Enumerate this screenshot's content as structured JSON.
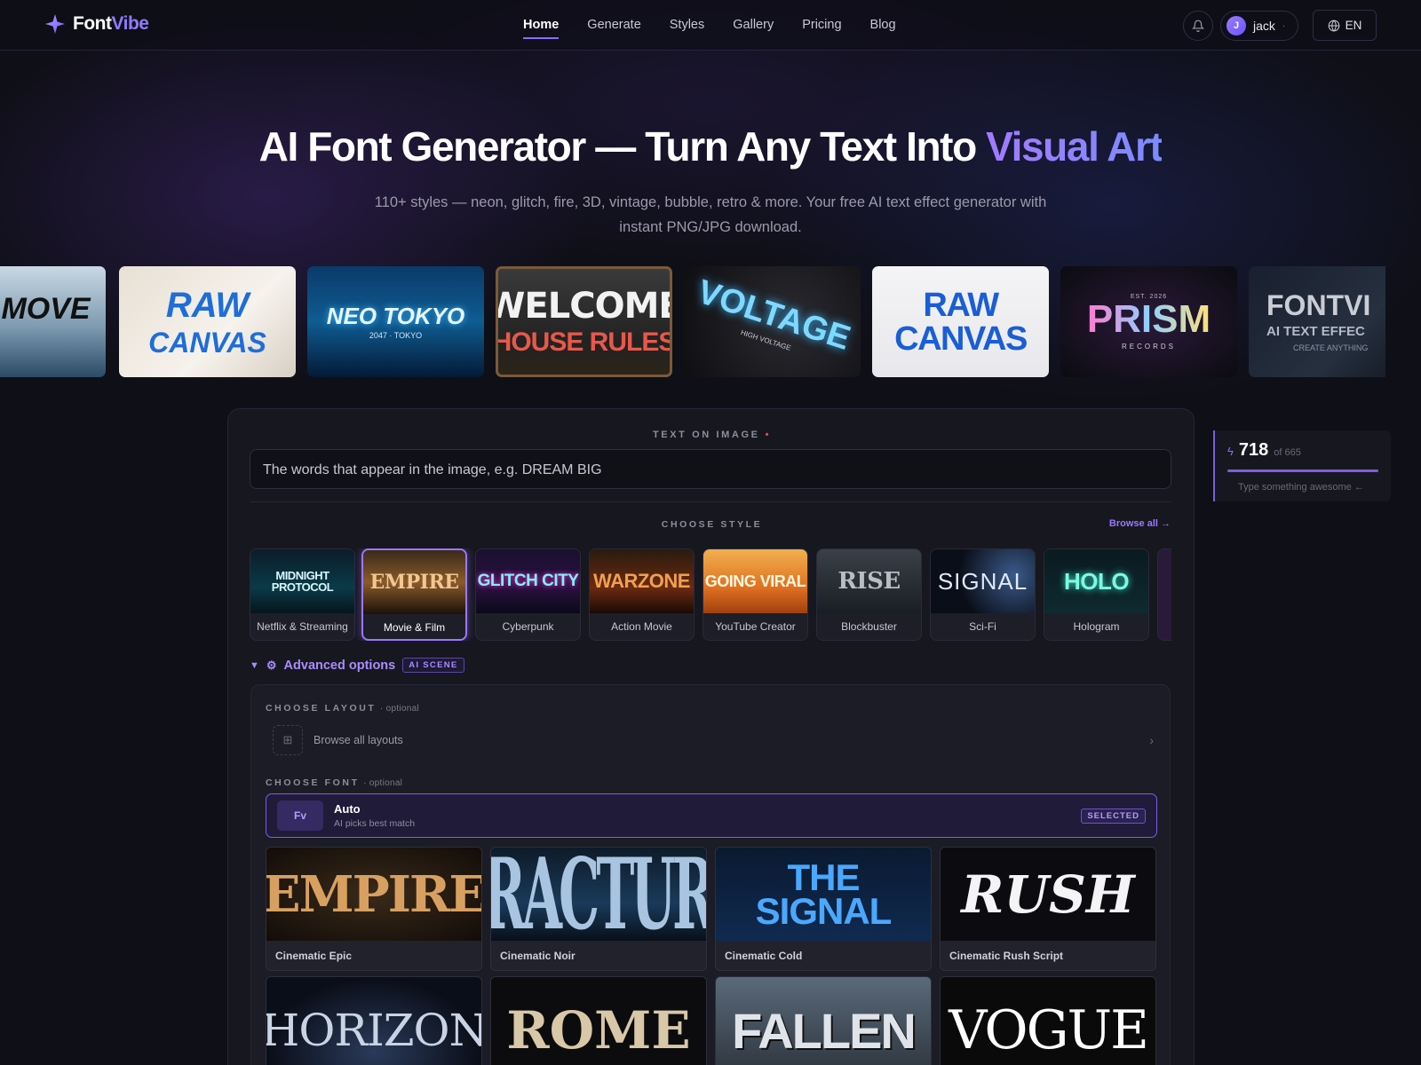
{
  "brand": {
    "name_a": "Font",
    "name_b": "Vibe"
  },
  "nav": {
    "links": [
      "Home",
      "Generate",
      "Styles",
      "Gallery",
      "Pricing",
      "Blog"
    ],
    "active": "Home",
    "user": {
      "initial": "J",
      "name": "jack"
    },
    "language": "EN"
  },
  "hero": {
    "title_main": "AI Font Generator — Turn Any Text Into ",
    "title_accent": "Visual Art",
    "subtitle": "110+ styles — neon, glitch, fire, 3D, vintage, bubble, retro & more. Your free AI text effect generator with instant PNG/JPG download."
  },
  "showcase": [
    {
      "line1": "D MOVE",
      "line2": ""
    },
    {
      "line1": "RAW",
      "line2": "CANVAS"
    },
    {
      "line1": "NEO TOKYO",
      "line2": "2047 · TOKYO"
    },
    {
      "line1": "WELCOME",
      "line2": "HOUSE RULES"
    },
    {
      "line1": "VOLTAGE",
      "line2": "HIGH VOLTAGE"
    },
    {
      "line1": "RAW CANVAS",
      "line2": ""
    },
    {
      "line1": "PRISM",
      "line2": "RECORDS",
      "line0": "EST. 2026"
    },
    {
      "line1": "FONTVI",
      "line2": "AI TEXT EFFEC",
      "line3": "CREATE ANYTHING"
    }
  ],
  "form": {
    "text_label": "TEXT ON IMAGE",
    "required_mark": "•",
    "text_placeholder": "The words that appear in the image, e.g. DREAM BIG",
    "style_label": "CHOOSE STYLE",
    "browse_all": "Browse all →",
    "styles": [
      {
        "thumb": "MIDNIGHT PROTOCOL",
        "label": "Netflix & Streaming"
      },
      {
        "thumb": "EMPIRE",
        "label": "Movie & Film"
      },
      {
        "thumb": "GLITCH CITY",
        "label": "Cyberpunk"
      },
      {
        "thumb": "WARZONE",
        "label": "Action Movie"
      },
      {
        "thumb": "GOING VIRAL",
        "label": "YouTube Creator"
      },
      {
        "thumb": "RISE",
        "label": "Blockbuster"
      },
      {
        "thumb": "SIGNAL",
        "label": "Sci-Fi"
      },
      {
        "thumb": "HOLO",
        "label": "Hologram"
      }
    ],
    "selected_style": "Movie & Film",
    "advanced_label": "Advanced options",
    "advanced_badge": "AI SCENE",
    "layout_label": "CHOOSE LAYOUT",
    "optional": "· optional",
    "layout_browse": "Browse all layouts",
    "font_label": "CHOOSE FONT",
    "auto_title": "Auto",
    "auto_sub": "AI picks best match",
    "selected_badge": "SELECTED",
    "fonts": [
      {
        "thumb": "EMPIRE",
        "label": "Cinematic Epic"
      },
      {
        "thumb": "FRACTURE",
        "label": "Cinematic Noir"
      },
      {
        "thumb": "THE SIGNAL",
        "label": "Cinematic Cold"
      },
      {
        "thumb": "RUSH",
        "label": "Cinematic Rush Script"
      },
      {
        "thumb": "HORIZON",
        "label": ""
      },
      {
        "thumb": "ROME",
        "label": ""
      },
      {
        "thumb": "FALLEN",
        "label": ""
      },
      {
        "thumb": "VOGUE",
        "label": ""
      }
    ]
  },
  "counter": {
    "value": "718",
    "of_text": "of 665",
    "hint": "Type something awesome ←"
  },
  "colors": {
    "accent": "#8b6cff",
    "background": "#0f0f17",
    "panel": "#17171f"
  }
}
